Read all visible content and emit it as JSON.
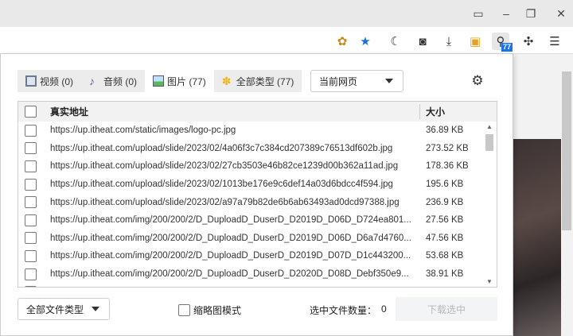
{
  "window": {
    "icons": [
      "layout-icon",
      "minimize-icon",
      "restore-icon",
      "close-icon"
    ]
  },
  "toolbar": {
    "extension_badge": "77"
  },
  "tabs": [
    {
      "label": "视频 (0)",
      "icon": "film-icon"
    },
    {
      "label": "音频 (0)",
      "icon": "music-note-icon"
    },
    {
      "label": "图片 (77)",
      "icon": "image-icon"
    },
    {
      "label": "全部类型 (77)",
      "icon": "asterisk-flower-icon"
    }
  ],
  "scope_select": {
    "value": "当前网页"
  },
  "table": {
    "headers": {
      "url": "真实地址",
      "size": "大小"
    },
    "rows": [
      {
        "url": "https://up.itheat.com/static/images/logo-pc.jpg",
        "size": "36.89 KB"
      },
      {
        "url": "https://up.itheat.com/upload/slide/2023/02/4a06f3c7c384cd207389c76513df602b.jpg",
        "size": "273.52 KB"
      },
      {
        "url": "https://up.itheat.com/upload/slide/2023/02/27cb3503e46b82ce1239d00b362a11ad.jpg",
        "size": "178.36 KB"
      },
      {
        "url": "https://up.itheat.com/upload/slide/2023/02/1013be176e9c6def14a03d6bdcc4f594.jpg",
        "size": "195.6 KB"
      },
      {
        "url": "https://up.itheat.com/upload/slide/2023/02/a97a79b82de6b6ab63493ad0dcd97388.jpg",
        "size": "236.9 KB"
      },
      {
        "url": "https://up.itheat.com/img/200/200/2/D_DuploadD_DuserD_D2019D_D06D_D724ea801...",
        "size": "27.56 KB"
      },
      {
        "url": "https://up.itheat.com/img/200/200/2/D_DuploadD_DuserD_D2019D_D06D_D6a7d4760...",
        "size": "47.56 KB"
      },
      {
        "url": "https://up.itheat.com/img/200/200/2/D_DuploadD_DuserD_D2019D_D07D_D1c443200...",
        "size": "53.68 KB"
      },
      {
        "url": "https://up.itheat.com/img/200/200/2/D_DuploadD_DuserD_D2020D_D08D_Debf350e9...",
        "size": "38.91 KB"
      }
    ]
  },
  "footer": {
    "file_type_select": "全部文件类型",
    "thumbnail_mode_label": "缩略图模式",
    "selected_count_label": "选中文件数量：",
    "selected_count": "0",
    "download_button": "下载选中"
  }
}
